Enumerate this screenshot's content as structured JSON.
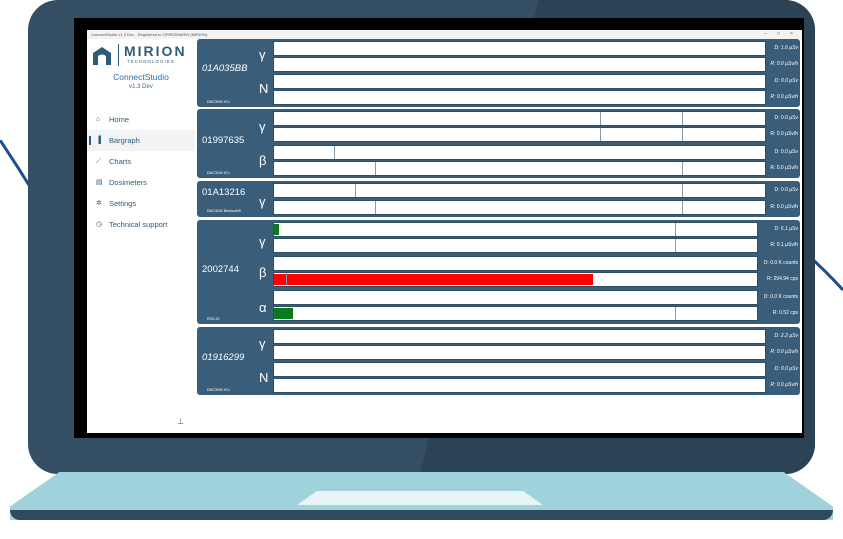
{
  "window": {
    "title": "ConnectStudio v1.3 Dev - Registered to OPREZMARIN (MIRION)",
    "controls": [
      "–",
      "□",
      "×"
    ],
    "restore_tab": "..."
  },
  "sidebar": {
    "brand": "MIRION",
    "brand_sub": "TECHNOLOGIES",
    "app_name": "ConnectStudio",
    "app_version": "v1.3 Dev",
    "items": [
      {
        "label": "Home",
        "icon": "home-icon",
        "glyph": "⌂"
      },
      {
        "label": "Bargraph",
        "icon": "bargraph-icon",
        "glyph": "▐"
      },
      {
        "label": "Charts",
        "icon": "chart-icon",
        "glyph": "⟋"
      },
      {
        "label": "Dosimeters",
        "icon": "dosimeter-icon",
        "glyph": "▤"
      },
      {
        "label": "Settings",
        "icon": "gear-icon",
        "glyph": "✲"
      },
      {
        "label": "Technical support",
        "icon": "support-icon",
        "glyph": "◷"
      }
    ],
    "active_item": "Bargraph",
    "pin_glyph": "⊥"
  },
  "devices": [
    {
      "id": "01A035BB",
      "model": "DMC3000 hTx",
      "italic": true,
      "rows": [
        {
          "symbol": "γ",
          "dose": "D: 1.6 µSv",
          "rate": "R: 0.0 µSv/h"
        },
        {
          "symbol": "N",
          "dose": "D: 0.0 µSv",
          "rate": "R: 0.0 µSv/h"
        }
      ]
    },
    {
      "id": "01997635",
      "model": "DMC3000 bTx",
      "italic": false,
      "rows": [
        {
          "symbol": "γ",
          "dose": "D: 0.0 µSv",
          "rate": "R: 0.0 µSv/h"
        },
        {
          "symbol": "β",
          "dose": "D: 0.0 µSv",
          "rate": "R: 0.0 µSv/h"
        }
      ]
    },
    {
      "id": "01A13216",
      "model": "DMC3000 Bluetooth®",
      "italic": false,
      "rows": [
        {
          "symbol": "γ",
          "dose": "D: 0.0 µSv",
          "rate": "R: 0.0 µSv/h"
        }
      ]
    },
    {
      "id": "2002744",
      "model": "RDS-32",
      "italic": false,
      "rows": [
        {
          "symbol": "γ",
          "dose": "D: 6.1 µSv",
          "rate": "R: 0.1 µSv/h",
          "dose_fill": 0.01
        },
        {
          "symbol": "β",
          "dose": "D: 0.0 K counts",
          "rate": "R: 294.94 cps",
          "rate_fill": 0.66
        },
        {
          "symbol": "α",
          "dose": "D: 0.0 K counts",
          "rate": "R: 0.52 cps",
          "rate_fill": 0.04
        }
      ]
    },
    {
      "id": "01916299",
      "model": "DMC3000 hTx",
      "italic": true,
      "rows": [
        {
          "symbol": "γ",
          "dose": "D: 2.2 µSv",
          "rate": "R: 0.0 µSv/h"
        },
        {
          "symbol": "N",
          "dose": "D: 0.0 µSv",
          "rate": "R: 0.0 µSv/h"
        }
      ]
    }
  ],
  "colors": {
    "accent": "#2f5c79",
    "card": "#3a5e7a",
    "beta_fill": "#ff0000",
    "gamma_fill": "#0a7a1e",
    "laptop_body": "#344f63",
    "laptop_base": "#9fd2da"
  }
}
